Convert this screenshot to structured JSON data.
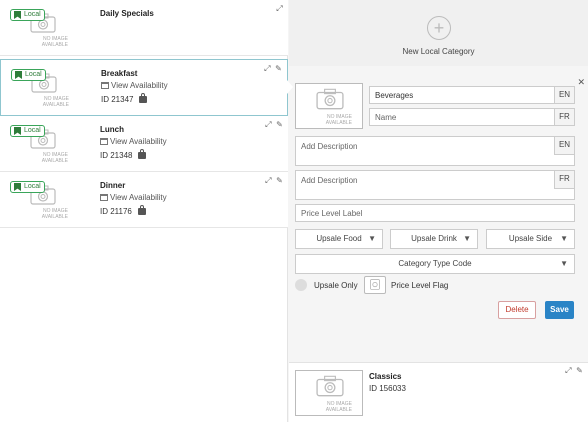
{
  "categories": [
    {
      "title": "Daily Specials",
      "badge": "Local",
      "no_image": "NO IMAGE AVAILABLE"
    },
    {
      "title": "Breakfast",
      "badge": "Local",
      "no_image": "NO IMAGE AVAILABLE",
      "availability": "View Availability",
      "id": "ID 21347"
    },
    {
      "title": "Lunch",
      "badge": "Local",
      "no_image": "NO IMAGE AVAILABLE",
      "availability": "View Availability",
      "id": "ID 21348"
    },
    {
      "title": "Dinner",
      "badge": "Local",
      "no_image": "NO IMAGE AVAILABLE",
      "availability": "View Availability",
      "id": "ID 21176"
    }
  ],
  "new_category": {
    "label": "New Local Category"
  },
  "form": {
    "no_image": "NO IMAGE AVAILABLE",
    "name_en": {
      "value": "Beverages",
      "lang": "EN"
    },
    "name_fr": {
      "placeholder": "Name",
      "lang": "FR"
    },
    "desc_en": {
      "placeholder": "Add Description",
      "lang": "EN"
    },
    "desc_fr": {
      "placeholder": "Add Description",
      "lang": "FR"
    },
    "price_level": {
      "placeholder": "Price Level Label"
    },
    "upsale_food": "Upsale Food",
    "upsale_drink": "Upsale Drink",
    "upsale_side": "Upsale Side",
    "category_type": "Category Type Code",
    "upsale_only": "Upsale Only",
    "price_level_flag": "Price Level Flag",
    "delete_label": "Delete",
    "save_label": "Save"
  },
  "classics": {
    "title": "Classics",
    "id": "ID 156033",
    "no_image": "NO IMAGE AVAILABLE"
  },
  "icons": [
    "expand-icon",
    "pencil-icon",
    "close-icon",
    "plus-icon",
    "camera-icon",
    "calendar-icon",
    "bag-icon",
    "bookmark-icon",
    "chevron-down-icon"
  ],
  "colors": {
    "accent": "#2a84c6",
    "local_green": "#2e7d3a",
    "delete_red": "#c0392b",
    "selected_border": "#8fc6cf"
  }
}
